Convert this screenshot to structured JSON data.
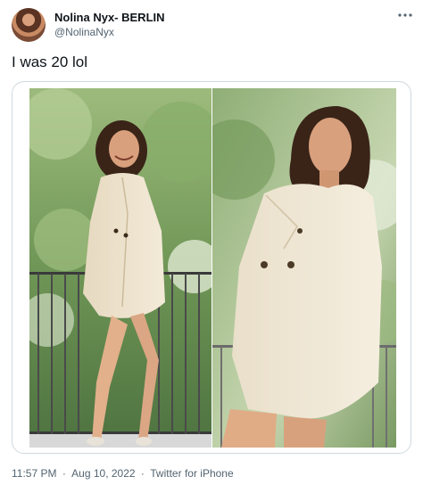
{
  "tweet": {
    "author": {
      "display_name": "Nolina Nyx- BERLIN",
      "handle": "@NolinaNyx",
      "avatar_icon": "profile-photo"
    },
    "more_icon": "more-horizontal-icon",
    "text": "I was 20 lol",
    "media": [
      {
        "type": "photo",
        "name": "photo-full-body"
      },
      {
        "type": "photo",
        "name": "photo-close-up"
      }
    ],
    "meta": {
      "time": "11:57 PM",
      "separator": "·",
      "date": "Aug 10, 2022",
      "source": "Twitter for iPhone"
    }
  },
  "colors": {
    "text": "#0f1419",
    "secondary": "#536471",
    "border": "#cfd9de"
  }
}
